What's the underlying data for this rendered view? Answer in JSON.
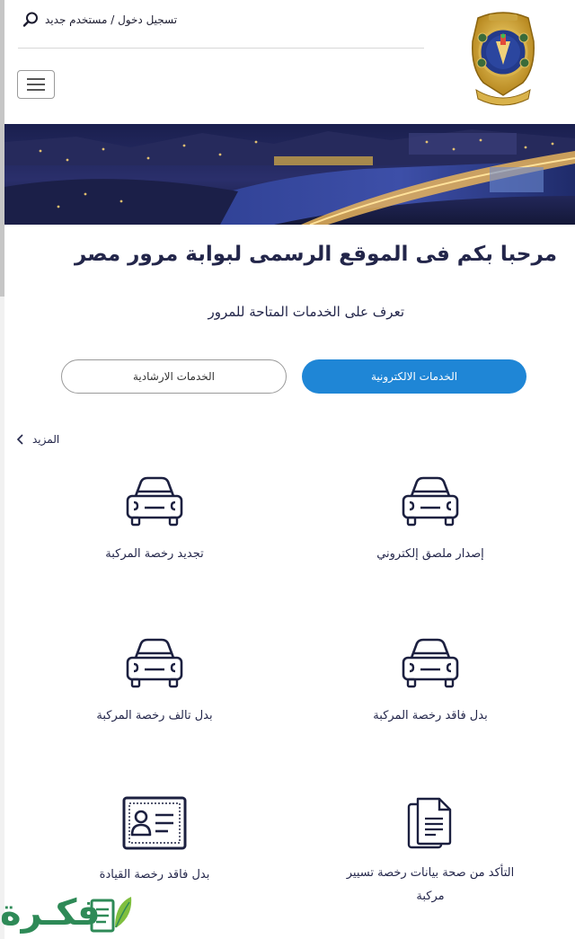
{
  "header": {
    "auth_label": "تسجيل دخول / مستخدم جديد",
    "search_icon": "search-icon",
    "menu_icon": "hamburger-menu-icon",
    "logo_icon": "traffic-department-emblem"
  },
  "welcome": {
    "title": "مرحبا بكم فى الموقع الرسمى لبوابة مرور مصر",
    "subtitle": "تعرف على الخدمات المتاحة للمرور"
  },
  "tabs": [
    {
      "label": "الخدمات الالكترونية",
      "active": true
    },
    {
      "label": "الخدمات الارشادية",
      "active": false
    }
  ],
  "more_link": "المزيد",
  "services": [
    {
      "label": "إصدار ملصق إلكتروني",
      "icon": "car-icon"
    },
    {
      "label": "تجديد رخصة المركبة",
      "icon": "car-icon"
    },
    {
      "label": "بدل فاقد رخصة المركبة",
      "icon": "car-icon"
    },
    {
      "label": "بدل تالف رخصة المركبة",
      "icon": "car-icon"
    },
    {
      "label_line1": "التأكد من صحة بيانات رخصة تسيير",
      "label_line2": "مركبة",
      "icon": "document-icon"
    },
    {
      "label": "بدل فاقد رخصة القيادة",
      "icon": "id-card-icon"
    }
  ],
  "watermark": {
    "text": "فكـرة"
  },
  "colors": {
    "accent": "#1f86d6",
    "text_dark": "#23264a",
    "watermark_green": "#2e8a57"
  }
}
